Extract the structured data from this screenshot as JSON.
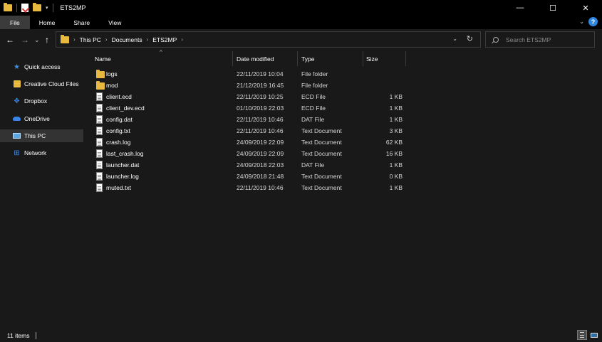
{
  "window": {
    "title": "ETS2MP",
    "controls": {
      "minimize": "—",
      "maximize": "☐",
      "close": "✕"
    }
  },
  "ribbon": {
    "tabs": [
      "File",
      "Home",
      "Share",
      "View"
    ],
    "help": "?"
  },
  "nav": {
    "back": "←",
    "forward": "→",
    "recent": "⌄",
    "up": "↑"
  },
  "address": {
    "crumbs": [
      "This PC",
      "Documents",
      "ETS2MP"
    ]
  },
  "search": {
    "placeholder": "Search ETS2MP"
  },
  "sidebar": {
    "items": [
      {
        "label": "Quick access",
        "icon": "star-icon",
        "color": "#3f8fe0"
      },
      {
        "label": "Creative Cloud Files",
        "icon": "creative-cloud-icon",
        "color": "#e8b93f"
      },
      {
        "label": "Dropbox",
        "icon": "dropbox-icon",
        "color": "#3a86e6"
      },
      {
        "label": "OneDrive",
        "icon": "onedrive-icon",
        "color": "#3a86e6"
      },
      {
        "label": "This PC",
        "icon": "computer-icon",
        "color": "#5aa9e6",
        "selected": true
      },
      {
        "label": "Network",
        "icon": "network-icon",
        "color": "#3a86e6"
      }
    ]
  },
  "columns": {
    "name": "Name",
    "date": "Date modified",
    "type": "Type",
    "size": "Size"
  },
  "files": [
    {
      "name": "logs",
      "date": "22/11/2019 10:04",
      "type": "File folder",
      "size": "",
      "icon": "folder-icon"
    },
    {
      "name": "mod",
      "date": "21/12/2019 16:45",
      "type": "File folder",
      "size": "",
      "icon": "folder-icon"
    },
    {
      "name": "client.ecd",
      "date": "22/11/2019 10:25",
      "type": "ECD File",
      "size": "1 KB",
      "icon": "file-icon"
    },
    {
      "name": "client_dev.ecd",
      "date": "01/10/2019 22:03",
      "type": "ECD File",
      "size": "1 KB",
      "icon": "file-icon"
    },
    {
      "name": "config.dat",
      "date": "22/11/2019 10:46",
      "type": "DAT File",
      "size": "1 KB",
      "icon": "file-icon"
    },
    {
      "name": "config.txt",
      "date": "22/11/2019 10:46",
      "type": "Text Document",
      "size": "3 KB",
      "icon": "file-icon"
    },
    {
      "name": "crash.log",
      "date": "24/09/2019 22:09",
      "type": "Text Document",
      "size": "62 KB",
      "icon": "file-icon"
    },
    {
      "name": "last_crash.log",
      "date": "24/09/2019 22:09",
      "type": "Text Document",
      "size": "16 KB",
      "icon": "file-icon"
    },
    {
      "name": "launcher.dat",
      "date": "24/09/2018 22:03",
      "type": "DAT File",
      "size": "1 KB",
      "icon": "file-icon"
    },
    {
      "name": "launcher.log",
      "date": "24/09/2018 21:48",
      "type": "Text Document",
      "size": "0 KB",
      "icon": "file-icon"
    },
    {
      "name": "muted.txt",
      "date": "22/11/2019 10:46",
      "type": "Text Document",
      "size": "1 KB",
      "icon": "file-icon"
    }
  ],
  "status": {
    "count": "11 items"
  }
}
